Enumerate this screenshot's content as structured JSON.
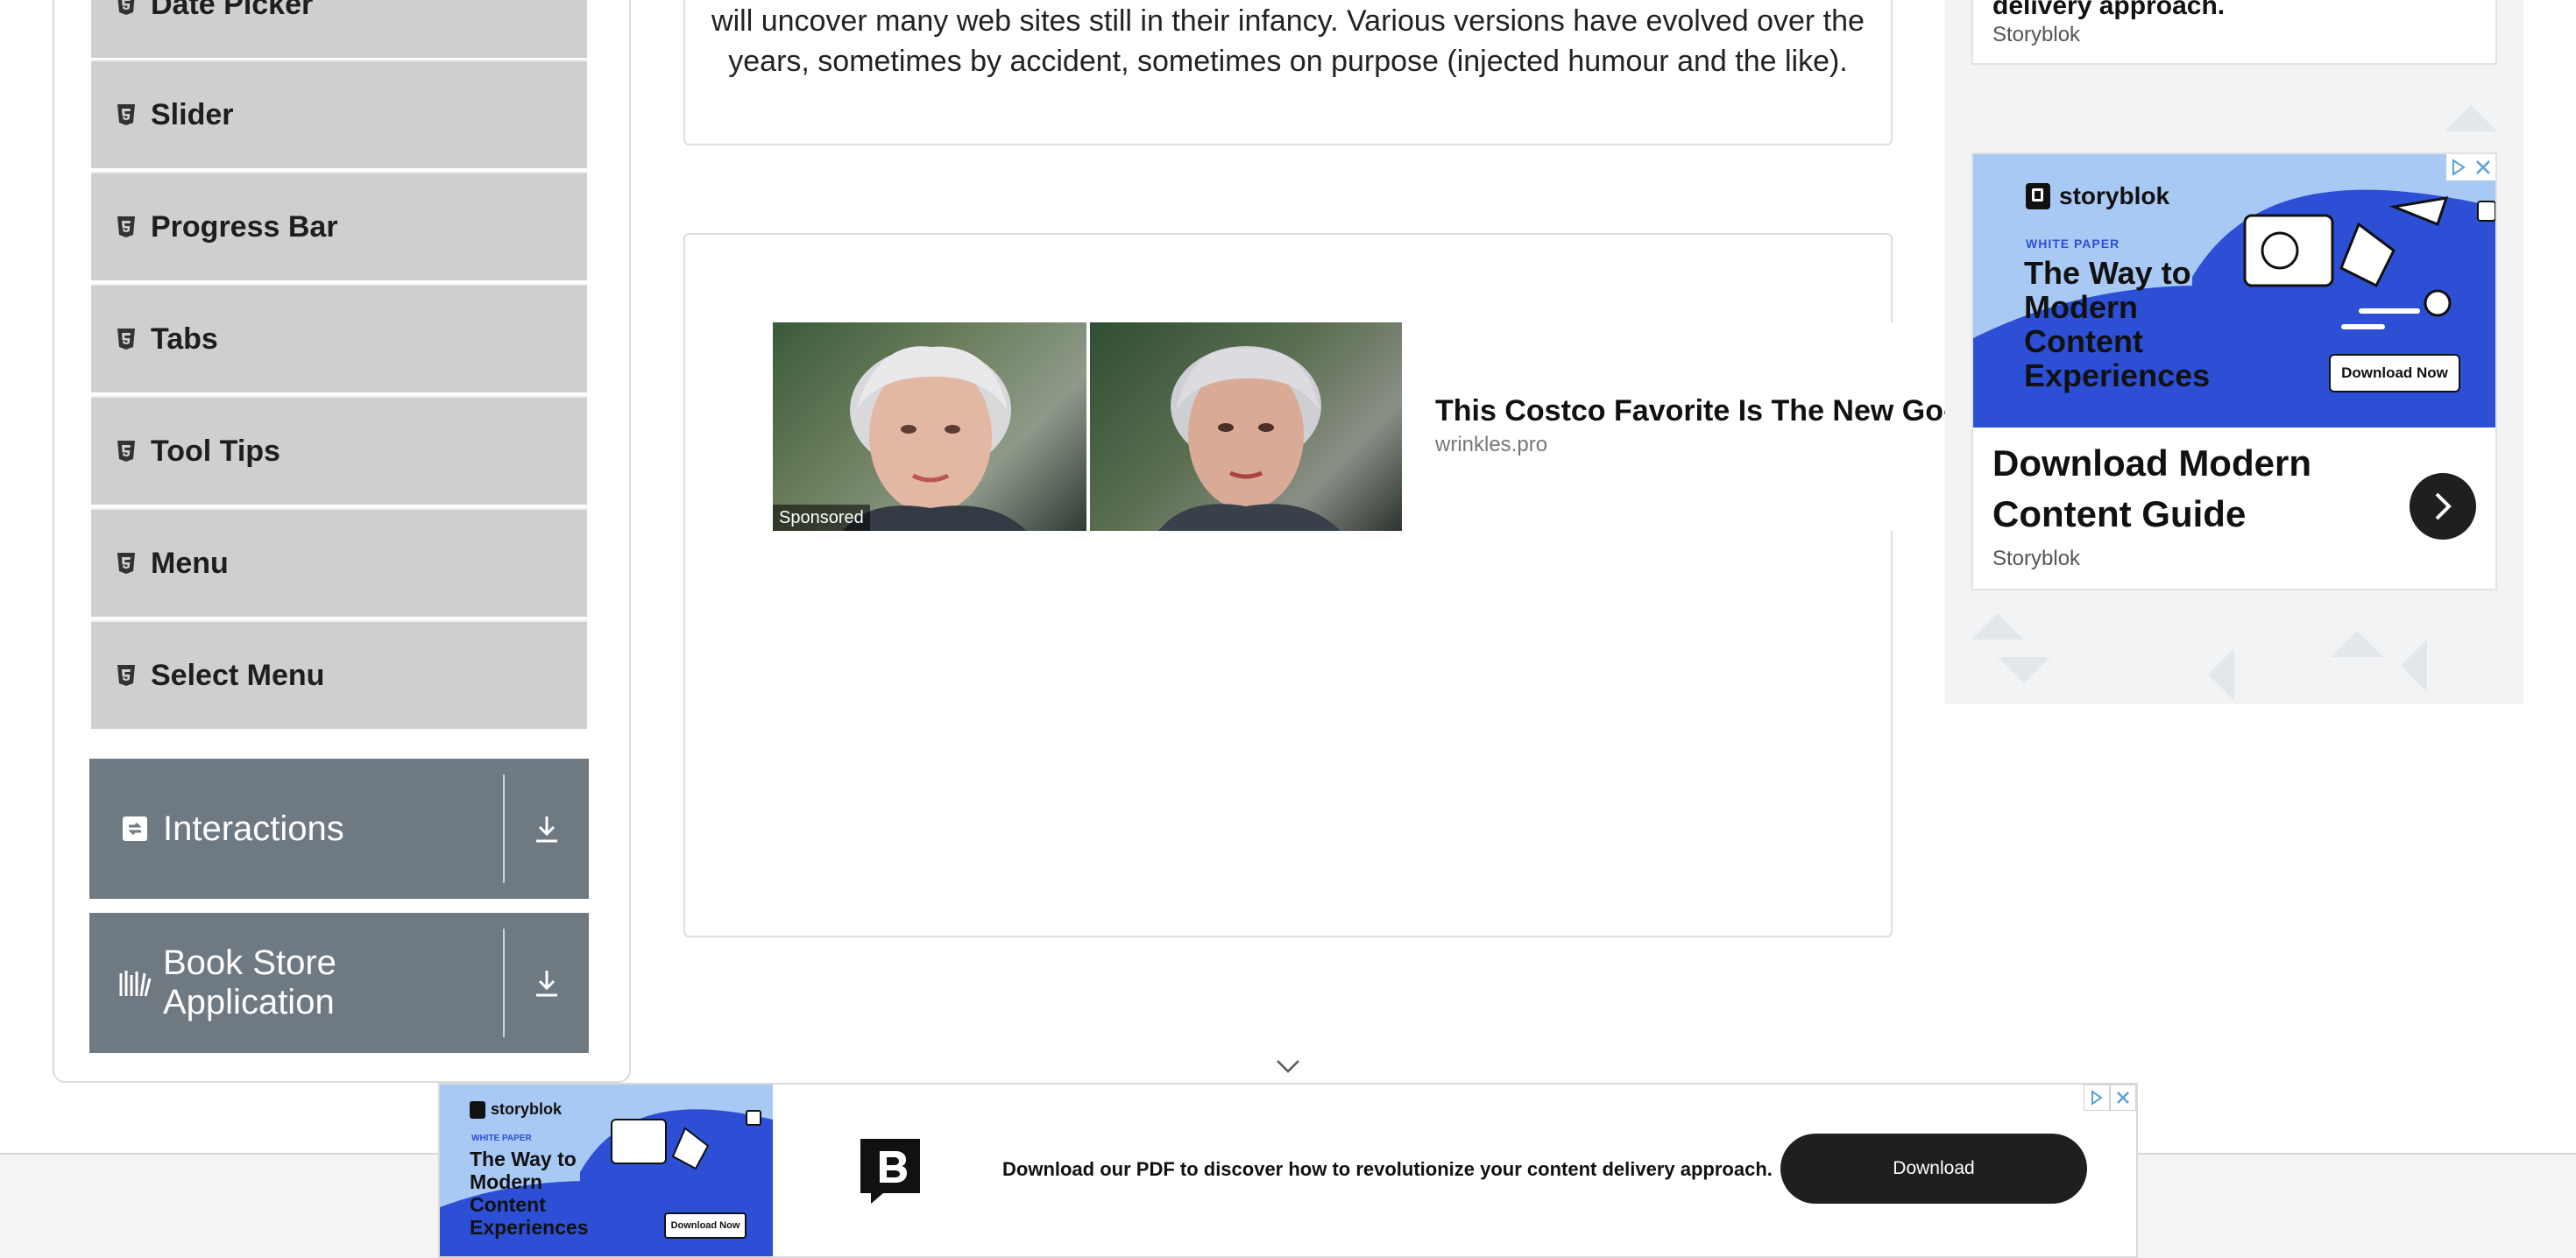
{
  "sidebar": {
    "items": [
      {
        "label": "Date Picker"
      },
      {
        "label": "Slider"
      },
      {
        "label": "Progress Bar"
      },
      {
        "label": "Tabs"
      },
      {
        "label": "Tool Tips"
      },
      {
        "label": "Menu"
      },
      {
        "label": "Select Menu"
      }
    ],
    "groups": [
      {
        "label": "Interactions"
      },
      {
        "label": "Book Store Application"
      }
    ]
  },
  "main": {
    "paragraph_line1": "will uncover many web sites still in their infancy. Various versions have evolved over the",
    "paragraph_line2": "years, sometimes by accident, sometimes on purpose (injected humour and the like).",
    "sponsored_ad": {
      "badge": "Sponsored",
      "headline": "This Costco Favorite Is The New Go-To",
      "domain": "wrinkles.pro"
    }
  },
  "right_ads": {
    "top_card": {
      "headline_partial": "delivery approach.",
      "brand": "Storyblok"
    },
    "card": {
      "logo": "storyblok",
      "kicker": "WHITE PAPER",
      "banner_title": "The Way to Modern Content Experiences",
      "banner_button": "Download Now",
      "headline": "Download Modern Content Guide",
      "brand": "Storyblok"
    }
  },
  "bottom_ad": {
    "logo": "storyblok",
    "kicker": "WHITE PAPER",
    "banner_title": "The Way to Modern Content Experiences",
    "banner_button": "Download Now",
    "text": "Download our PDF to discover how to revolutionize your content delivery approach.",
    "cta": "Download"
  },
  "colors": {
    "menu_item_bg": "#cfcfcf",
    "group_bg": "#6f7982",
    "ad_blue": "#2c4fd6",
    "ad_light_blue": "#a9c9f5"
  }
}
